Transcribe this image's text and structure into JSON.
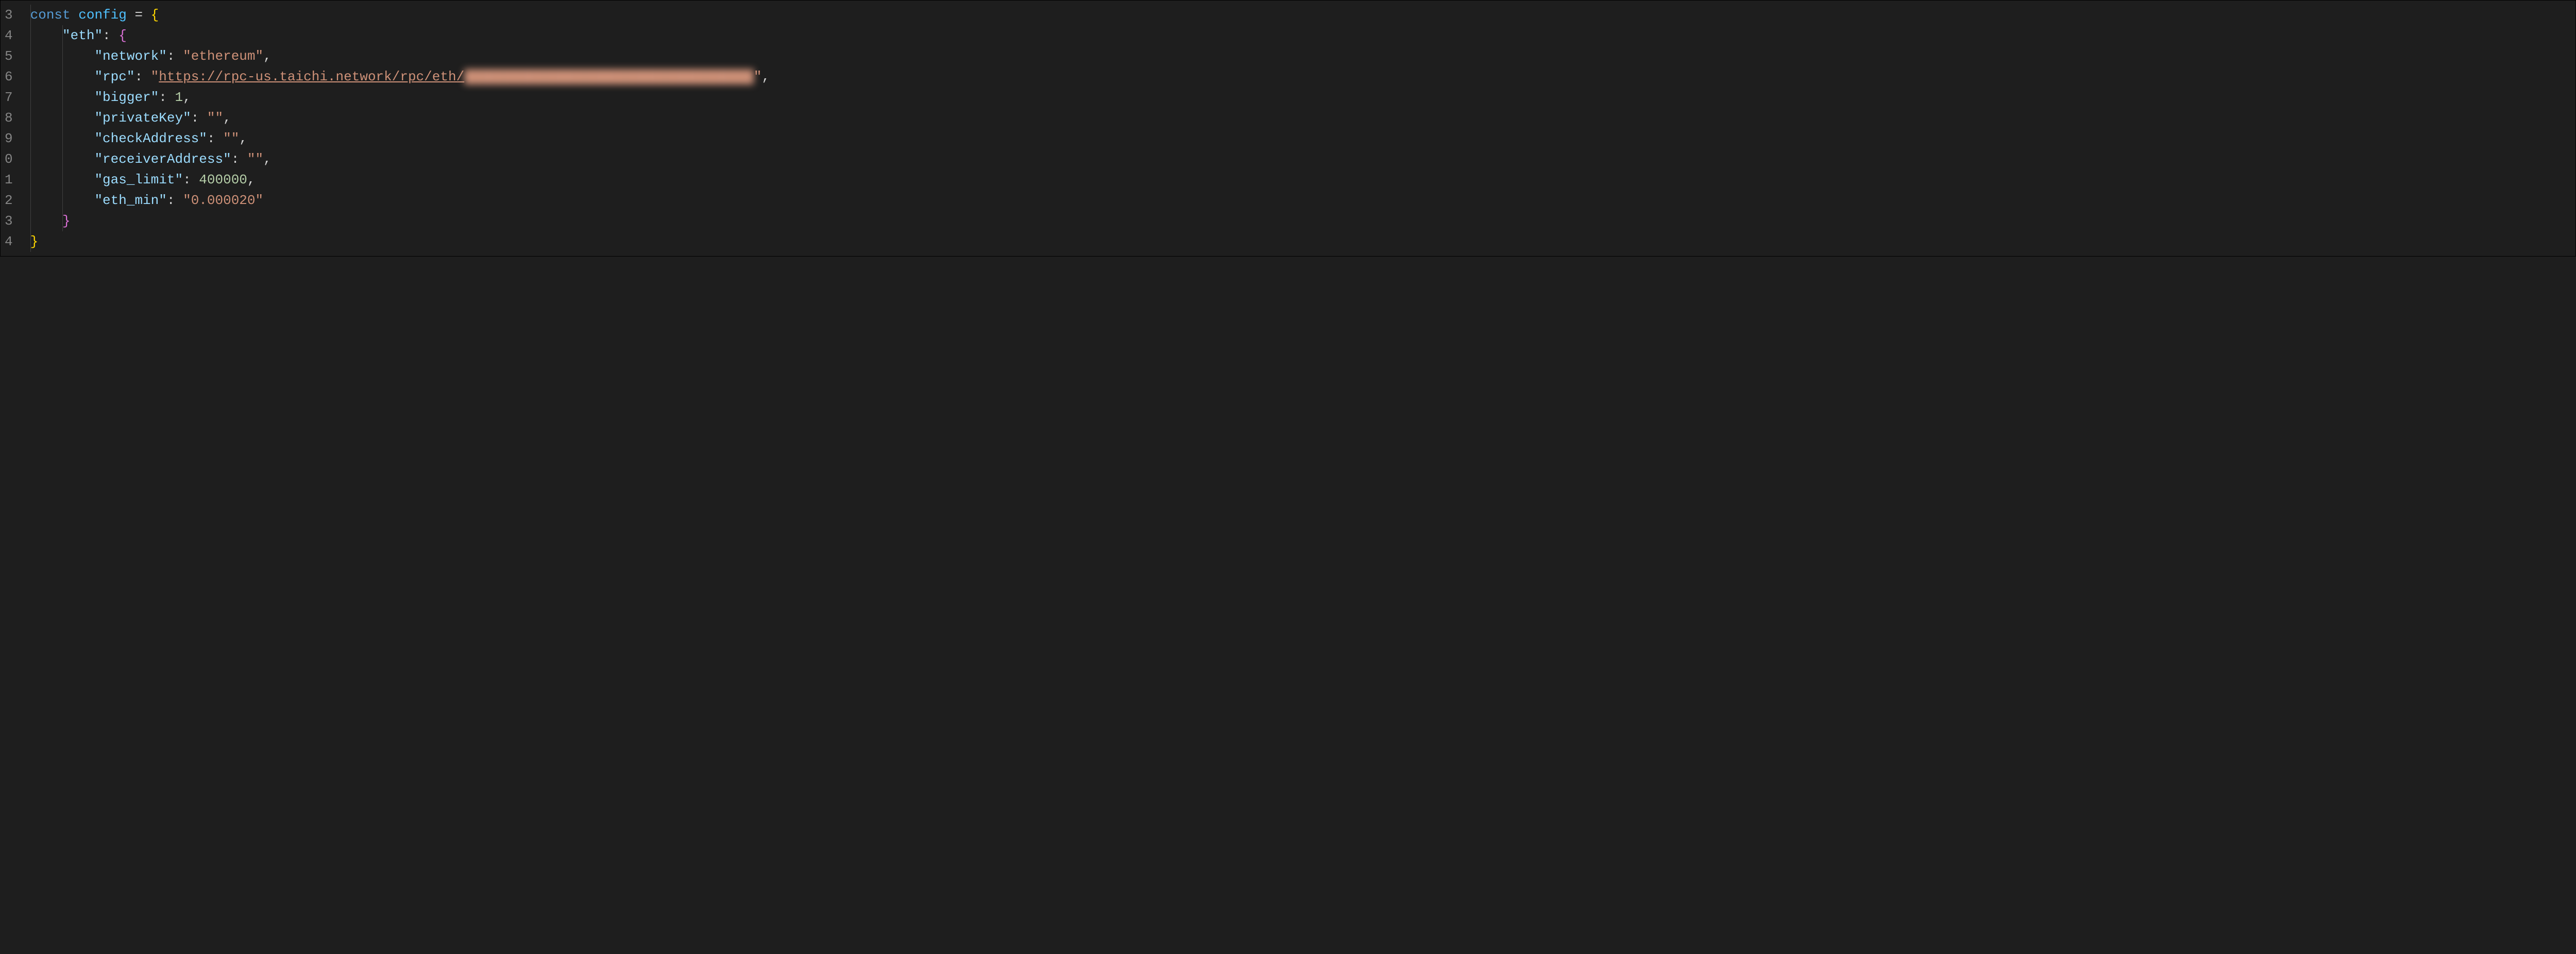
{
  "lineNumbers": [
    "3",
    "4",
    "5",
    "6",
    "7",
    "8",
    "9",
    "0",
    "1",
    "2",
    "3",
    "4"
  ],
  "code": {
    "const_kw": "const",
    "config_var": "config",
    "equals": " = ",
    "eth_key": "\"eth\"",
    "network_key": "\"network\"",
    "network_val": "\"ethereum\"",
    "rpc_key": "\"rpc\"",
    "rpc_val_prefix": "\"",
    "rpc_url_visible": "https://rpc-us.taichi.network/rpc/eth/",
    "rpc_url_blurred": "████████████████████████████████████",
    "rpc_val_suffix": "\"",
    "bigger_key": "\"bigger\"",
    "bigger_val": "1",
    "privateKey_key": "\"privateKey\"",
    "privateKey_val": "\"\"",
    "checkAddress_key": "\"checkAddress\"",
    "checkAddress_val": "\"\"",
    "receiverAddress_key": "\"receiverAddress\"",
    "receiverAddress_val": "\"\"",
    "gas_limit_key": "\"gas_limit\"",
    "gas_limit_val": "400000",
    "eth_min_key": "\"eth_min\"",
    "eth_min_val": "\"0.000020\""
  }
}
